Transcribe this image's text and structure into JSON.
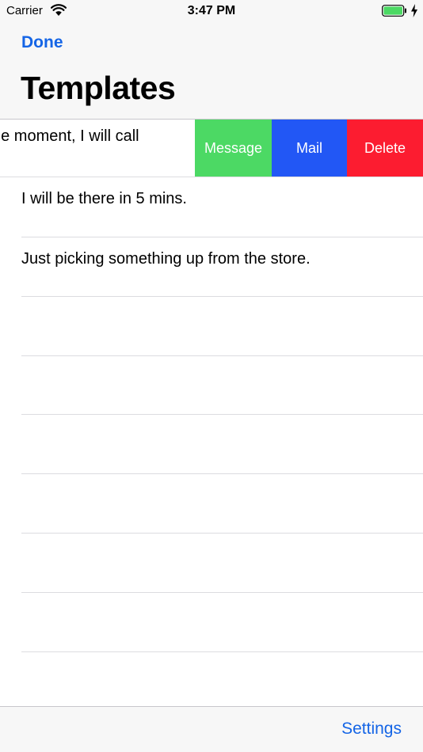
{
  "status_bar": {
    "carrier": "Carrier",
    "time": "3:47 PM",
    "battery_color": "#4cd964"
  },
  "nav": {
    "done_label": "Done",
    "title": "Templates"
  },
  "templates": {
    "swiped_text": "he moment, I will call",
    "items": [
      "I will be there in 5 mins.",
      "Just picking something up from the store."
    ]
  },
  "actions": {
    "message_label": "Message",
    "message_color": "#4cd964",
    "mail_label": "Mail",
    "mail_color": "#2257f5",
    "delete_label": "Delete",
    "delete_color": "#fc1c30"
  },
  "toolbar": {
    "settings_label": "Settings"
  },
  "colors": {
    "accent": "#1565e6"
  }
}
